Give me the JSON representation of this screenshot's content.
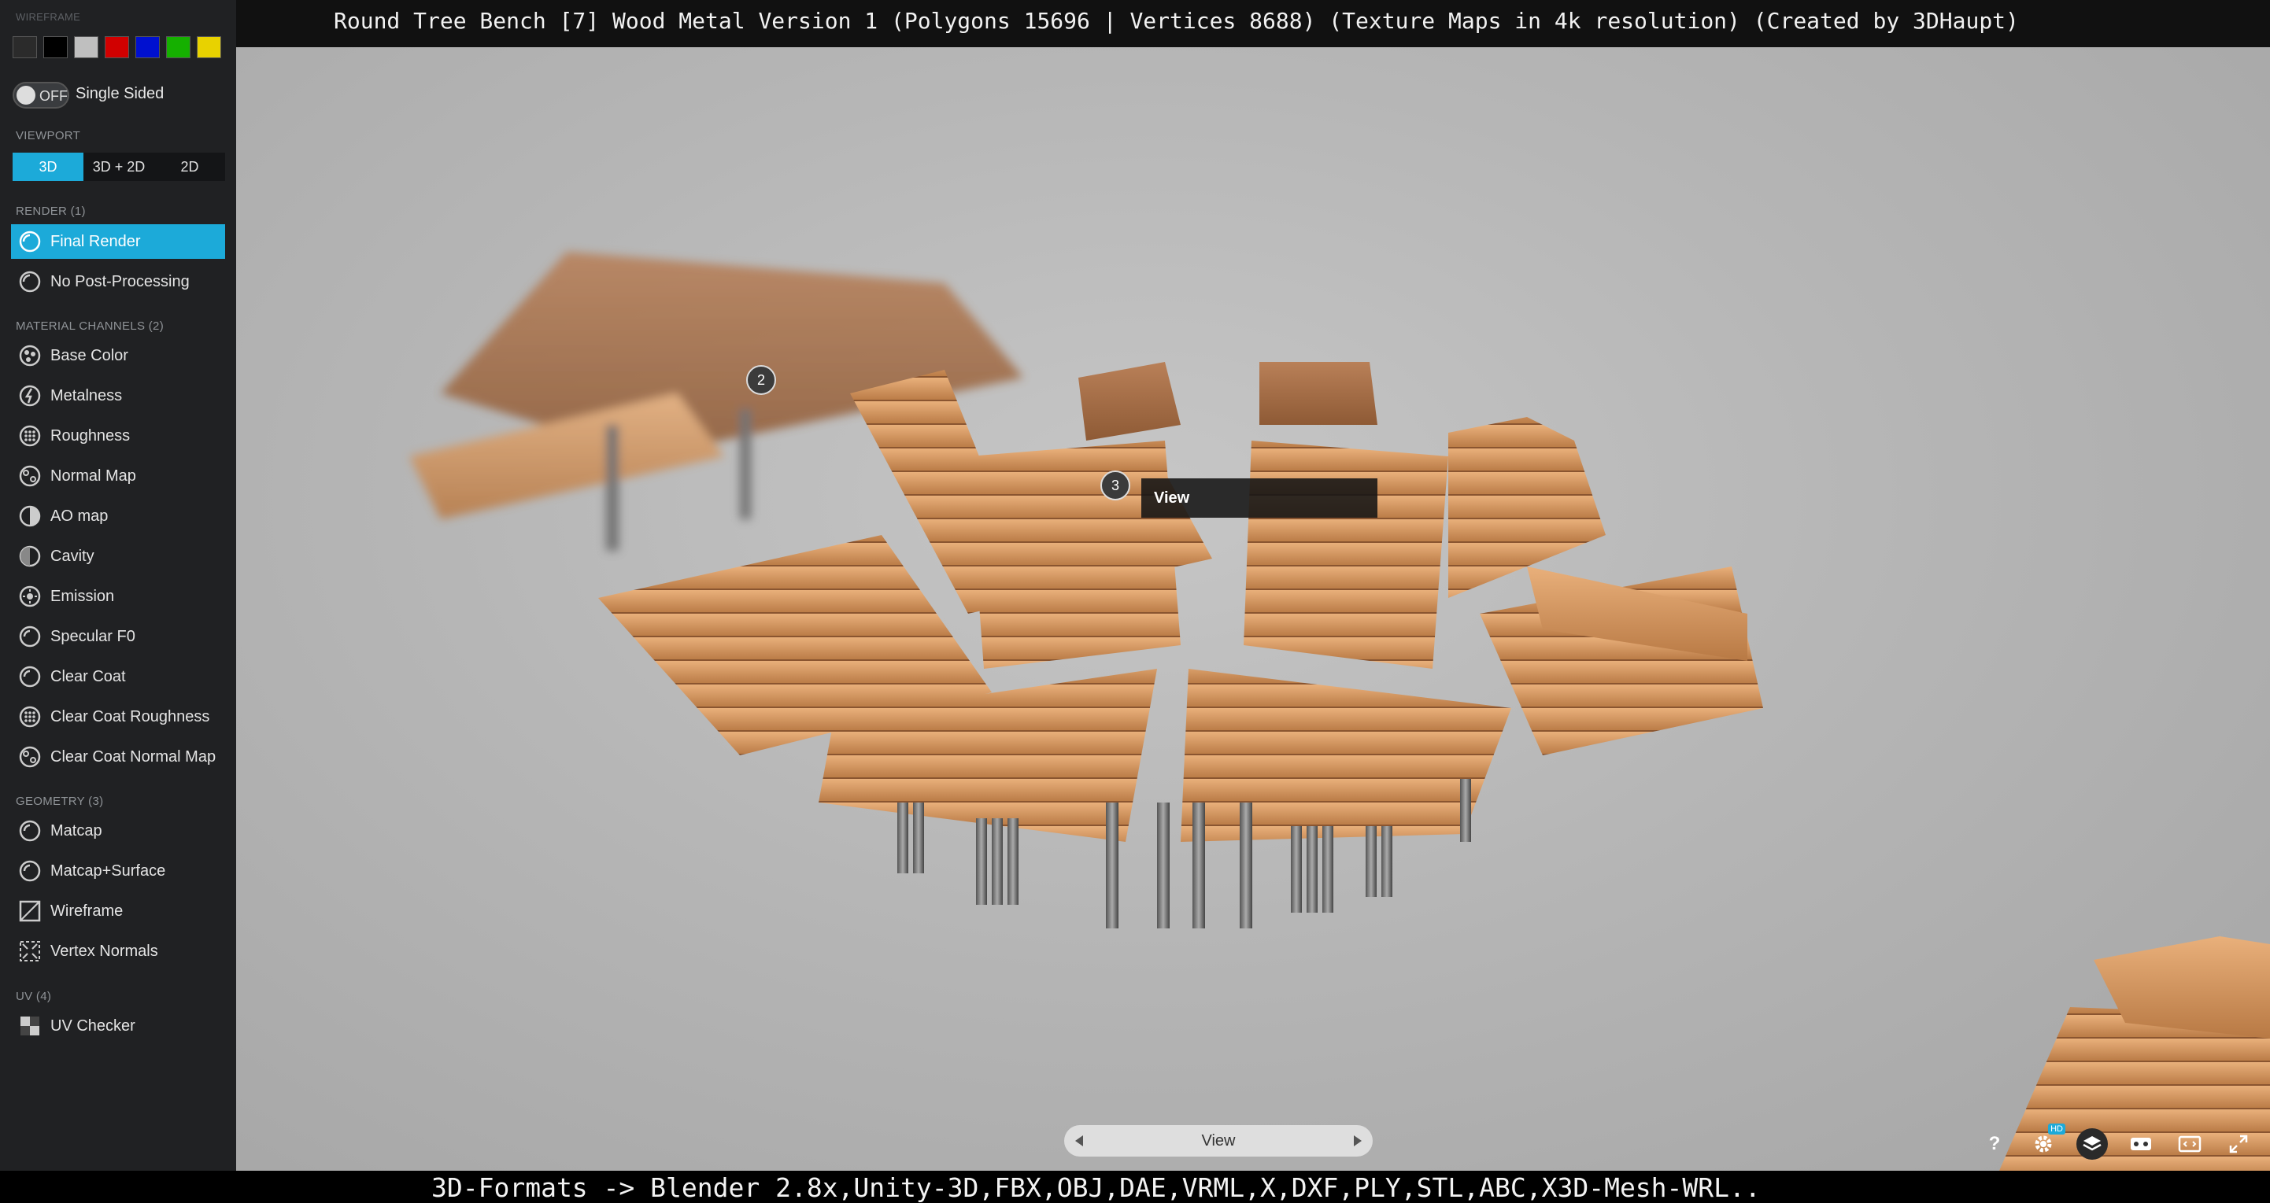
{
  "window": {
    "title": "Round Tree Bench [7] Wood Metal Version 1 (Polygons 15696 | Vertices 8688) (Texture Maps in 4k resolution) (Created by 3DHaupt)"
  },
  "sidebar": {
    "wireframe_label": "WIREFRAME",
    "wireframe_colors": [
      "#2b2b2b",
      "#000000",
      "#bfbfbf",
      "#d10000",
      "#0010d0",
      "#15b000",
      "#e8d200"
    ],
    "single_sided": {
      "state": "OFF",
      "label": "Single Sided"
    },
    "viewport": {
      "label": "VIEWPORT",
      "options": [
        "3D",
        "3D + 2D",
        "2D"
      ],
      "selected": "3D"
    },
    "render": {
      "label": "RENDER (1)",
      "items": [
        {
          "label": "Final Render",
          "icon": "render-icon",
          "active": true
        },
        {
          "label": "No Post-Processing",
          "icon": "render-icon",
          "active": false
        }
      ]
    },
    "material_channels": {
      "label": "MATERIAL CHANNELS (2)",
      "items": [
        {
          "label": "Base Color",
          "icon": "base-color-icon"
        },
        {
          "label": "Metalness",
          "icon": "metalness-icon"
        },
        {
          "label": "Roughness",
          "icon": "roughness-icon"
        },
        {
          "label": "Normal Map",
          "icon": "normal-map-icon"
        },
        {
          "label": "AO map",
          "icon": "ao-map-icon"
        },
        {
          "label": "Cavity",
          "icon": "cavity-icon"
        },
        {
          "label": "Emission",
          "icon": "emission-icon"
        },
        {
          "label": "Specular F0",
          "icon": "specular-icon"
        },
        {
          "label": "Clear Coat",
          "icon": "clear-coat-icon"
        },
        {
          "label": "Clear Coat Roughness",
          "icon": "clear-coat-roughness-icon"
        },
        {
          "label": "Clear Coat Normal Map",
          "icon": "clear-coat-normal-icon"
        }
      ]
    },
    "geometry": {
      "label": "GEOMETRY (3)",
      "items": [
        {
          "label": "Matcap",
          "icon": "matcap-icon"
        },
        {
          "label": "Matcap+Surface",
          "icon": "matcap-surface-icon"
        },
        {
          "label": "Wireframe",
          "icon": "wireframe-icon"
        },
        {
          "label": "Vertex Normals",
          "icon": "vertex-normals-icon"
        }
      ]
    },
    "uv": {
      "label": "UV (4)",
      "items": [
        {
          "label": "UV Checker",
          "icon": "uv-checker-icon"
        }
      ]
    }
  },
  "viewport": {
    "hotspots": [
      "2",
      "3"
    ],
    "tooltip": "View",
    "view_bar": {
      "label": "View"
    },
    "toolbar_icons": [
      "help-icon",
      "settings-hd-icon",
      "layers-icon",
      "vr-icon",
      "embed-icon",
      "fullscreen-icon"
    ],
    "hd_badge": "HD",
    "help_label": "?",
    "accent_color": "#1caad9"
  },
  "footer": {
    "text": "3D-Formats -> Blender 2.8x,Unity-3D,FBX,OBJ,DAE,VRML,X,DXF,PLY,STL,ABC,X3D-Mesh-WRL.."
  }
}
